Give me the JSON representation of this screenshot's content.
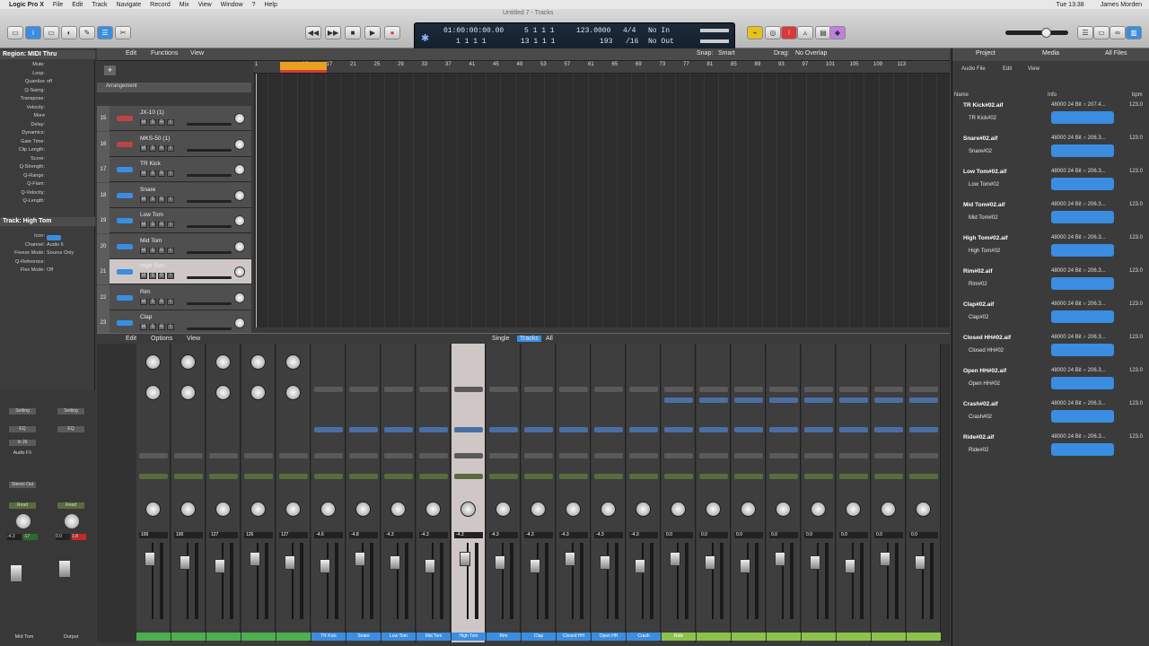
{
  "menubar": {
    "app": "Logic Pro X",
    "items": [
      "File",
      "Edit",
      "Track",
      "Navigate",
      "Record",
      "Mix",
      "View",
      "Window",
      "?",
      "Help"
    ],
    "clock": "Tue 13:38",
    "user": "James Morden"
  },
  "window_title": "Untitled 7 - Tracks",
  "lcd": {
    "position": "01:00:00:00.00",
    "bars": "5  1  1      1",
    "bars2": "1  1  1      1",
    "beats": "13  1  1      1",
    "tempo": "123.0000",
    "tempo2": "193",
    "sig": "4/4",
    "sig2": "/16",
    "in": "No In",
    "out": "No Out"
  },
  "tracks_bar": {
    "edit": "Edit",
    "functions": "Functions",
    "view": "View",
    "snap_label": "Snap:",
    "snap": "Smart",
    "drag_label": "Drag:",
    "drag": "No Overlap"
  },
  "inspector": {
    "region_head": "Region: MIDI Thru",
    "region_rows": [
      {
        "k": "Mute:",
        "v": ""
      },
      {
        "k": "Loop:",
        "v": ""
      },
      {
        "k": "Quantize",
        "v": "off"
      },
      {
        "k": "Q-Swing:",
        "v": ""
      },
      {
        "k": "Transpose:",
        "v": ""
      },
      {
        "k": "Velocity:",
        "v": ""
      },
      {
        "k": "More",
        "v": ""
      },
      {
        "k": "Delay:",
        "v": ""
      },
      {
        "k": "Dynamics:",
        "v": ""
      },
      {
        "k": "Gate Time:",
        "v": ""
      },
      {
        "k": "Clip Length:",
        "v": ""
      },
      {
        "k": "Score:",
        "v": ""
      },
      {
        "k": "Q-Strength:",
        "v": ""
      },
      {
        "k": "Q-Range:",
        "v": ""
      },
      {
        "k": "Q-Flam:",
        "v": ""
      },
      {
        "k": "Q-Velocity:",
        "v": ""
      },
      {
        "k": "Q-Length:",
        "v": ""
      }
    ],
    "track_head": "Track: High Tom",
    "track_rows": [
      {
        "k": "Icon:",
        "v": ""
      },
      {
        "k": "Channel:",
        "v": "Audio 6"
      },
      {
        "k": "Freeze Mode:",
        "v": "Source Only"
      },
      {
        "k": "Q-Reference:",
        "v": ""
      },
      {
        "k": "Flex Mode:",
        "v": "Off"
      }
    ]
  },
  "arrangement_label": "Arrangement",
  "tracks": [
    {
      "num": "15",
      "name": "JX-10  (1)"
    },
    {
      "num": "16",
      "name": "MKS-50  (1)"
    },
    {
      "num": "17",
      "name": "TR Kick"
    },
    {
      "num": "18",
      "name": "Snare"
    },
    {
      "num": "19",
      "name": "Low Tom"
    },
    {
      "num": "20",
      "name": "Mid Tom"
    },
    {
      "num": "21",
      "name": "High Tom"
    },
    {
      "num": "22",
      "name": "Rim"
    },
    {
      "num": "23",
      "name": "Clap"
    }
  ],
  "ruler": [
    "1",
    "",
    "13",
    "17",
    "21",
    "25",
    "29",
    "33",
    "37",
    "41",
    "45",
    "49",
    "53",
    "57",
    "61",
    "65",
    "69",
    "73",
    "77",
    "81",
    "85",
    "89",
    "93",
    "97",
    "101",
    "105",
    "109",
    "113"
  ],
  "mixer_bar": {
    "edit": "Edit",
    "options": "Options",
    "view": "View",
    "single": "Single",
    "tracks": "Tracks",
    "all": "All"
  },
  "mixer": [
    {
      "name": "",
      "db": "100"
    },
    {
      "name": "",
      "db": "100"
    },
    {
      "name": "",
      "db": "127"
    },
    {
      "name": "",
      "db": "126"
    },
    {
      "name": "",
      "db": "127"
    },
    {
      "name": "TR Kick",
      "db": "-4.6"
    },
    {
      "name": "Snare",
      "db": "-4.8"
    },
    {
      "name": "Low Tom",
      "db": "-4.3"
    },
    {
      "name": "Mid Tom",
      "db": "-4.3"
    },
    {
      "name": "High Tom",
      "db": "-4.3"
    },
    {
      "name": "Rim",
      "db": "-4.3"
    },
    {
      "name": "Clap",
      "db": "-4.3"
    },
    {
      "name": "Closed HH",
      "db": "-4.3"
    },
    {
      "name": "Open HH",
      "db": "-4.3"
    },
    {
      "name": "Crash",
      "db": "-4.3"
    },
    {
      "name": "Ride",
      "db": "0.0"
    },
    {
      "name": "",
      "db": "0.0"
    },
    {
      "name": "",
      "db": "0.0"
    },
    {
      "name": "",
      "db": "0.0"
    },
    {
      "name": "",
      "db": "0.0"
    },
    {
      "name": "",
      "db": "0.0"
    },
    {
      "name": "",
      "db": "0.0"
    },
    {
      "name": "",
      "db": "0.0"
    }
  ],
  "left_strips": {
    "a": "Mid Tom",
    "b": "Output",
    "a_db": "-4.3",
    "a_pk": "-17",
    "b_db": "0.0",
    "b_pk": "1.8",
    "setting": "Setting",
    "eq": "EQ",
    "in": "In 26",
    "audio_fx": "Audio FX",
    "stereo_out": "Stereo Out",
    "read": "Read"
  },
  "browser": {
    "tabs": [
      "Project",
      "Media",
      "All Files"
    ],
    "audio_file": "Audio File",
    "edit": "Edit",
    "view": "View",
    "col_name": "Name",
    "col_info": "Info",
    "col_bpm": "bpm",
    "files": [
      {
        "file": "TR Kick#02.aif",
        "sub": "TR Kick#02",
        "info": "48000 24 Bit  ○  207.4...",
        "bpm": "123.0"
      },
      {
        "file": "Snare#02.aif",
        "sub": "Snare#02",
        "info": "48000 24 Bit  ○  206.3...",
        "bpm": "123.0"
      },
      {
        "file": "Low Tom#02.aif",
        "sub": "Low Tom#02",
        "info": "48000 24 Bit  ○  206.3...",
        "bpm": "123.0"
      },
      {
        "file": "Mid Tom#02.aif",
        "sub": "Mid Tom#02",
        "info": "48000 24 Bit  ○  206.3...",
        "bpm": "123.0"
      },
      {
        "file": "High Tom#02.aif",
        "sub": "High Tom#02",
        "info": "48000 24 Bit  ○  206.3...",
        "bpm": "123.0"
      },
      {
        "file": "Rim#02.aif",
        "sub": "Rim#02",
        "info": "48000 24 Bit  ○  206.3...",
        "bpm": "123.0"
      },
      {
        "file": "Clap#02.aif",
        "sub": "Clap#02",
        "info": "48000 24 Bit  ○  206.3...",
        "bpm": "123.0"
      },
      {
        "file": "Closed HH#02.aif",
        "sub": "Closed HH#02",
        "info": "48000 24 Bit  ○  206.3...",
        "bpm": "123.0"
      },
      {
        "file": "Open HH#02.aif",
        "sub": "Open HH#02",
        "info": "48000 24 Bit  ○  206.3...",
        "bpm": "123.0"
      },
      {
        "file": "Crash#02.aif",
        "sub": "Crash#02",
        "info": "48000 24 Bit  ○  206.3...",
        "bpm": "123.0"
      },
      {
        "file": "Ride#02.aif",
        "sub": "Ride#02",
        "info": "48000 24 Bit  ○  206.3...",
        "bpm": "123.0"
      }
    ]
  },
  "colors": {
    "accent": "#3a8de0",
    "record": "#d93a3a",
    "selected_track": "#cfc6c6"
  }
}
